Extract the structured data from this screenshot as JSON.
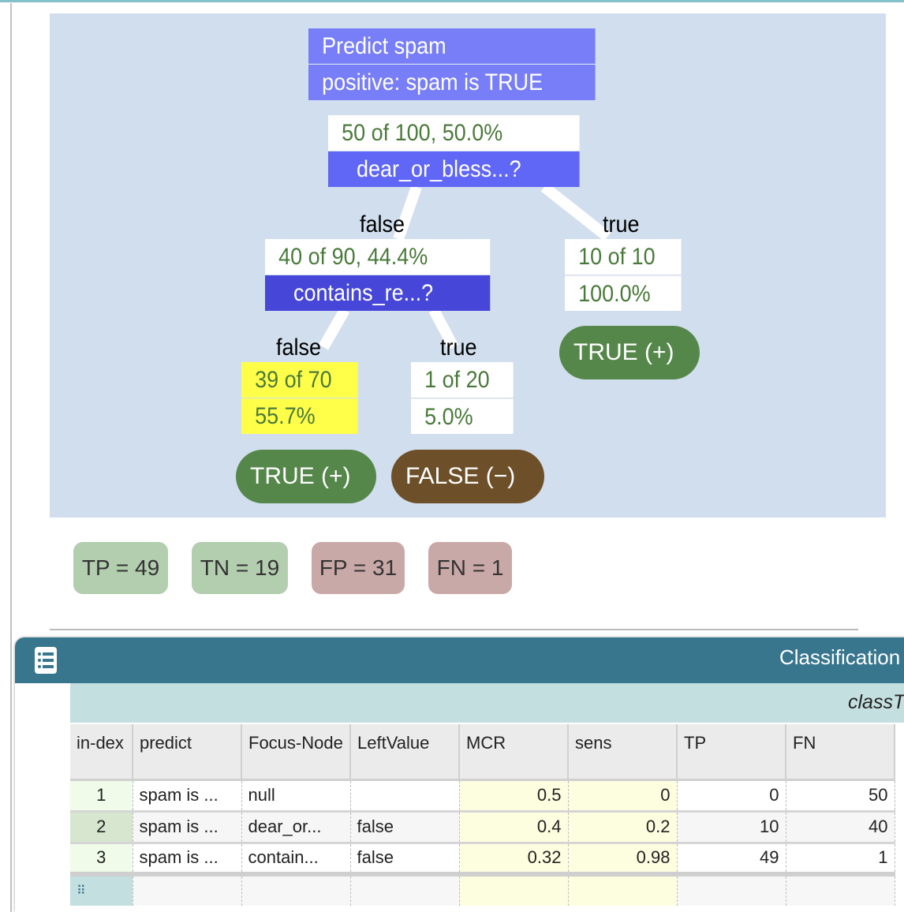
{
  "tree": {
    "title": "Predict spam",
    "positive": "positive: spam is TRUE",
    "root": {
      "stat": "50 of 100, 50.0%",
      "question": "dear_or_bless...?"
    },
    "left_label": "false",
    "right_label": "true",
    "left": {
      "stat": "40 of 90, 44.4%",
      "question": "contains_re...?"
    },
    "right": {
      "stat1": "10 of 10",
      "stat2": "100.0%",
      "leaf": "TRUE (+)"
    },
    "ll_label": "false",
    "lr_label": "true",
    "ll": {
      "stat1": "39 of 70",
      "stat2": "55.7%",
      "leaf": "TRUE (+)"
    },
    "lr": {
      "stat1": "1 of 20",
      "stat2": "5.0%",
      "leaf": "FALSE (−)"
    }
  },
  "confusion": {
    "tp": "TP = 49",
    "tn": "TN = 19",
    "fp": "FP = 31",
    "fn": "FN = 1"
  },
  "colors": {
    "header": "#787ef7",
    "root_q": "#6066f5",
    "left_q": "#4646d8",
    "true_leaf": "#55874a",
    "false_leaf": "#6d5029",
    "highlight": "#ffff4a",
    "panel": "#38768e"
  },
  "table": {
    "panel_title": "Classification",
    "group_title": "classT",
    "columns": [
      "in-dex",
      "predict",
      "Focus-Node",
      "LeftValue",
      "MCR",
      "sens",
      "TP",
      "FN"
    ],
    "rows": [
      [
        "1",
        "spam is ...",
        "null",
        "",
        "0.5",
        "0",
        "0",
        "50"
      ],
      [
        "2",
        "spam is ...",
        "dear_or...",
        "false",
        "0.4",
        "0.2",
        "10",
        "40"
      ],
      [
        "3",
        "spam is ...",
        "contain...",
        "false",
        "0.32",
        "0.98",
        "49",
        "1"
      ]
    ]
  }
}
